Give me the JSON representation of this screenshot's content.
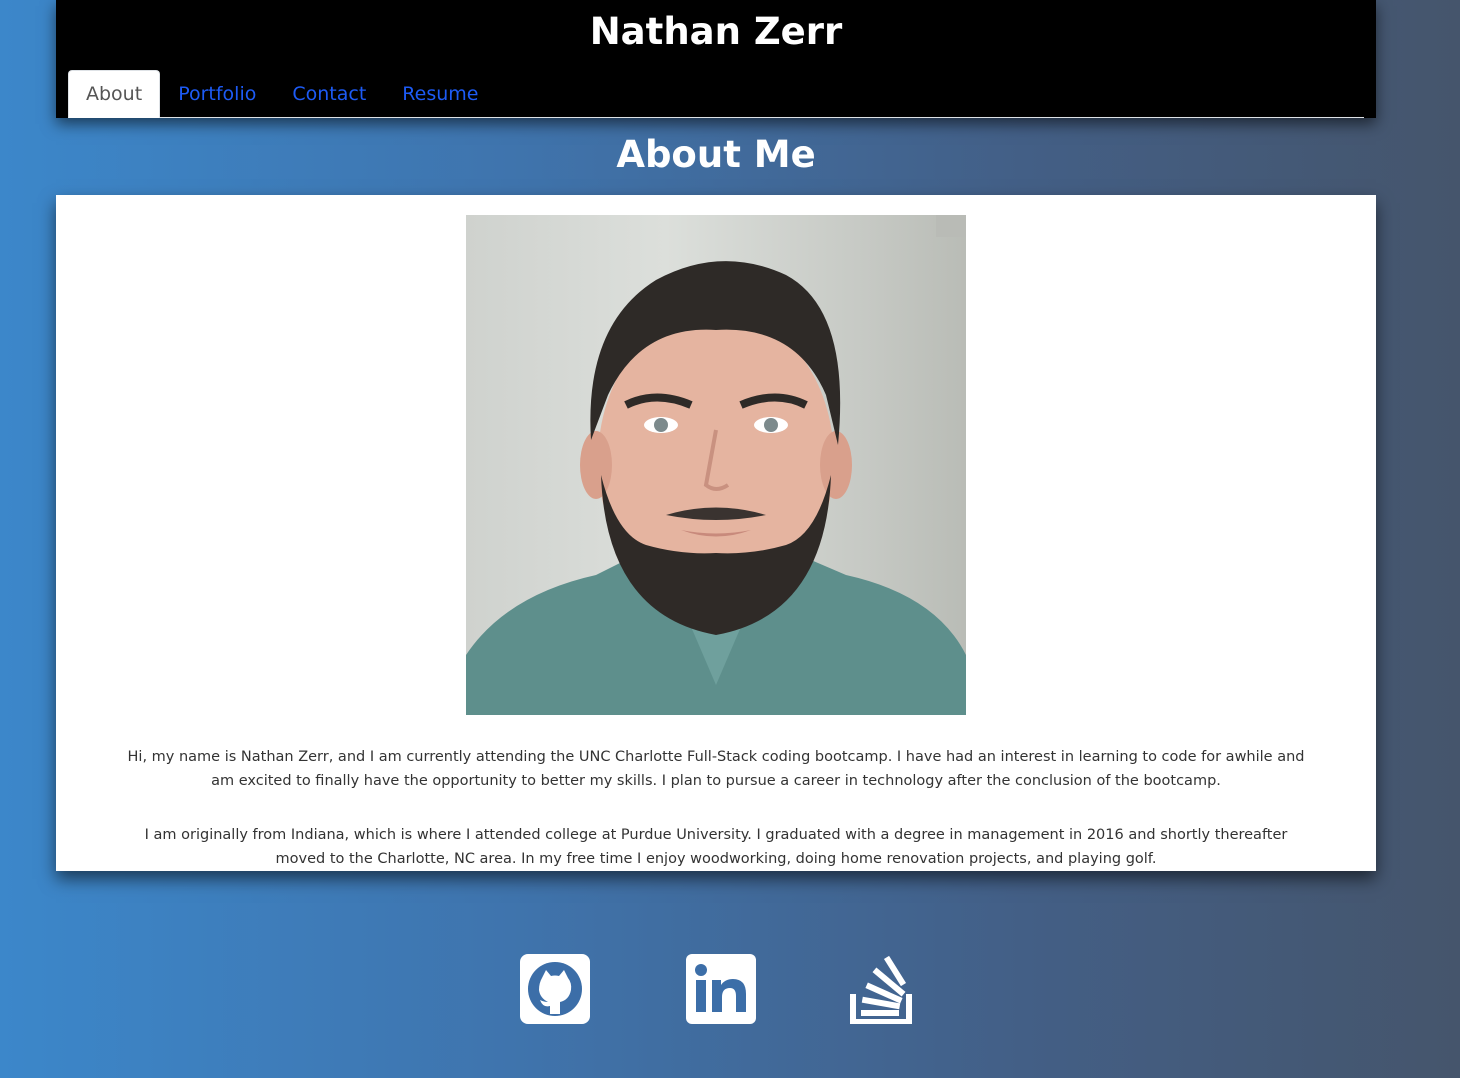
{
  "header": {
    "title": "Nathan Zerr"
  },
  "nav": {
    "tabs": [
      {
        "label": "About",
        "active": true
      },
      {
        "label": "Portfolio",
        "active": false
      },
      {
        "label": "Contact",
        "active": false
      },
      {
        "label": "Resume",
        "active": false
      }
    ]
  },
  "about": {
    "heading": "About Me",
    "photo_icon": "profile-photo",
    "paragraphs": [
      "Hi, my name is Nathan Zerr, and I am currently attending the UNC Charlotte Full-Stack coding bootcamp. I have had an interest in learning to code for awhile and am excited to finally have the opportunity to better my skills. I plan to pursue a career in technology after the conclusion of the bootcamp.",
      "I am originally from Indiana, which is where I attended college at Purdue University. I graduated with a degree in management in 2016 and shortly thereafter moved to the Charlotte, NC area. In my free time I enjoy woodworking, doing home renovation projects, and playing golf."
    ]
  },
  "footer": {
    "social_icons": [
      "github-icon",
      "linkedin-icon",
      "stackoverflow-icon"
    ]
  },
  "colors": {
    "header_bg": "#000000",
    "link": "#1d5bf5",
    "background_left": "#3c87ca",
    "background_right": "#45556c"
  }
}
